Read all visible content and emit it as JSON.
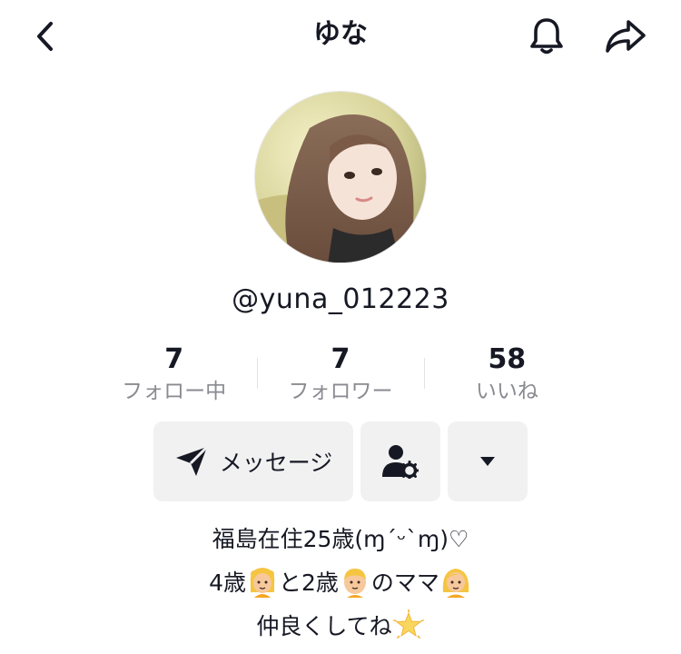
{
  "header": {
    "title": "ゆな"
  },
  "profile": {
    "username": "@yuna_012223"
  },
  "stats": [
    {
      "value": "7",
      "label": "フォロー中"
    },
    {
      "value": "7",
      "label": "フォロワー"
    },
    {
      "value": "58",
      "label": "いいね"
    }
  ],
  "actions": {
    "message_label": "メッセージ"
  },
  "bio": {
    "line1": "福島在住25歳(ɱ´ᵕ`ɱ)♡",
    "line2_a": "4歳",
    "line2_b": "と2歳",
    "line2_c": "のママ",
    "line3": "仲良くしてね"
  },
  "icons": {
    "back": "chevron-left-icon",
    "bell": "bell-icon",
    "share": "share-arrow-icon",
    "send": "send-icon",
    "user_settings": "user-gear-icon",
    "dropdown": "caret-down-icon",
    "emoji_girl": "girl-emoji-icon",
    "emoji_boy": "boy-emoji-icon",
    "emoji_woman": "woman-emoji-icon",
    "emoji_star": "glowing-star-emoji-icon"
  }
}
